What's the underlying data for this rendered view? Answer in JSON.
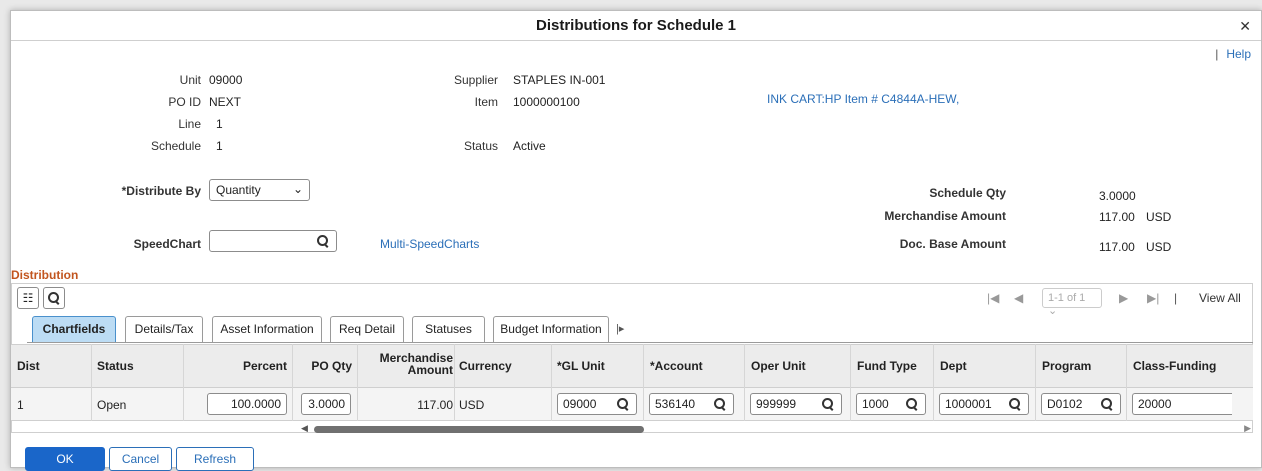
{
  "dialog": {
    "title": "Distributions for Schedule 1",
    "close_icon": "close-icon",
    "help_sep": "|",
    "help_label": "Help"
  },
  "header": {
    "unit_label": "Unit",
    "unit_value": "09000",
    "poid_label": "PO ID",
    "poid_value": "NEXT",
    "line_label": "Line",
    "line_value": "1",
    "schedule_label": "Schedule",
    "schedule_value": "1",
    "supplier_label": "Supplier",
    "supplier_value": "STAPLES IN-001",
    "item_label": "Item",
    "item_value": "1000000100",
    "status_label": "Status",
    "status_value": "Active",
    "item_desc_link": "INK CART:HP Item # C4844A-HEW,"
  },
  "distribute": {
    "label": "*Distribute By",
    "selected": "Quantity",
    "speedchart_label": "SpeedChart",
    "speedchart_value": "",
    "multi_speedcharts": "Multi-SpeedCharts"
  },
  "summary": {
    "schedule_qty_label": "Schedule Qty",
    "schedule_qty_value": "3.0000",
    "merch_amount_label": "Merchandise Amount",
    "merch_amount_value": "117.00",
    "merch_currency": "USD",
    "doc_base_label": "Doc. Base Amount",
    "doc_base_value": "117.00",
    "doc_base_currency": "USD"
  },
  "grid": {
    "section_title": "Distribution",
    "pager_first": "|◀",
    "pager_prev": "◀",
    "pager_range": "1-1 of 1",
    "pager_next": "▶",
    "pager_last": "▶|",
    "pager_sep": "|",
    "view_all": "View All",
    "tabs": [
      "Chartfields",
      "Details/Tax",
      "Asset Information",
      "Req Detail",
      "Statuses",
      "Budget Information"
    ],
    "columns": {
      "dist": "Dist",
      "status": "Status",
      "percent": "Percent",
      "po_qty": "PO Qty",
      "merch_l1": "Merchandise",
      "merch_l2": "Amount",
      "currency": "Currency",
      "gl_unit": "*GL Unit",
      "account": "*Account",
      "oper_unit": "Oper Unit",
      "fund_type": "Fund Type",
      "dept": "Dept",
      "program": "Program",
      "class_funding": "Class-Funding"
    },
    "rows": [
      {
        "dist": "1",
        "status": "Open",
        "percent": "100.0000",
        "po_qty": "3.0000",
        "merch_amount": "117.00",
        "currency": "USD",
        "gl_unit": "09000",
        "account": "536140",
        "oper_unit": "999999",
        "fund_type": "1000",
        "dept": "1000001",
        "program": "D0102",
        "class_funding": "20000"
      }
    ]
  },
  "buttons": {
    "ok": "OK",
    "cancel": "Cancel",
    "refresh": "Refresh"
  }
}
